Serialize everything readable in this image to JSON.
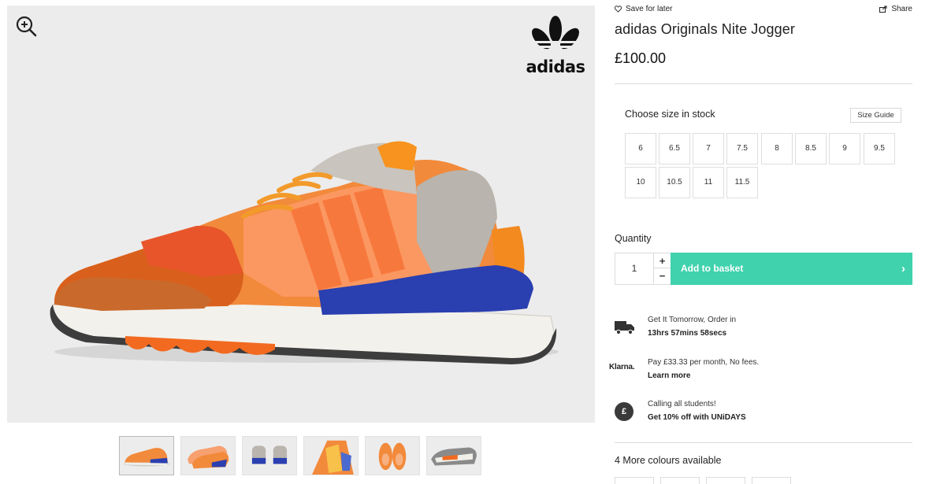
{
  "gallery": {
    "brand": "adidas",
    "zoom_icon": "zoom-in-icon",
    "thumbnails": [
      "side-view",
      "pair-view",
      "back-view",
      "top-detail-view",
      "front-view",
      "sole-view"
    ]
  },
  "top_actions": {
    "save_label": "Save for later",
    "share_label": "Share"
  },
  "product": {
    "title": "adidas Originals Nite Jogger",
    "price": "£100.00"
  },
  "size": {
    "label": "Choose size in stock",
    "guide_label": "Size Guide",
    "options": [
      "6",
      "6.5",
      "7",
      "7.5",
      "8",
      "8.5",
      "9",
      "9.5",
      "10",
      "10.5",
      "11",
      "11.5"
    ]
  },
  "quantity": {
    "label": "Quantity",
    "value": "1",
    "inc": "+",
    "dec": "−"
  },
  "basket": {
    "label": "Add to basket",
    "chevron": "›",
    "color": "#3fd2ad"
  },
  "delivery": {
    "line1": "Get It Tomorrow, Order in",
    "line2": "13hrs 57mins 58secs"
  },
  "klarna": {
    "logo": "Klarna.",
    "line1": "Pay £33.33 per month, No fees.",
    "line2": "Learn more"
  },
  "students": {
    "symbol": "£",
    "line1": "Calling all students!",
    "line2": "Get 10% off with UNiDAYS"
  },
  "colours": {
    "label": "4 More colours available",
    "count": 4
  }
}
